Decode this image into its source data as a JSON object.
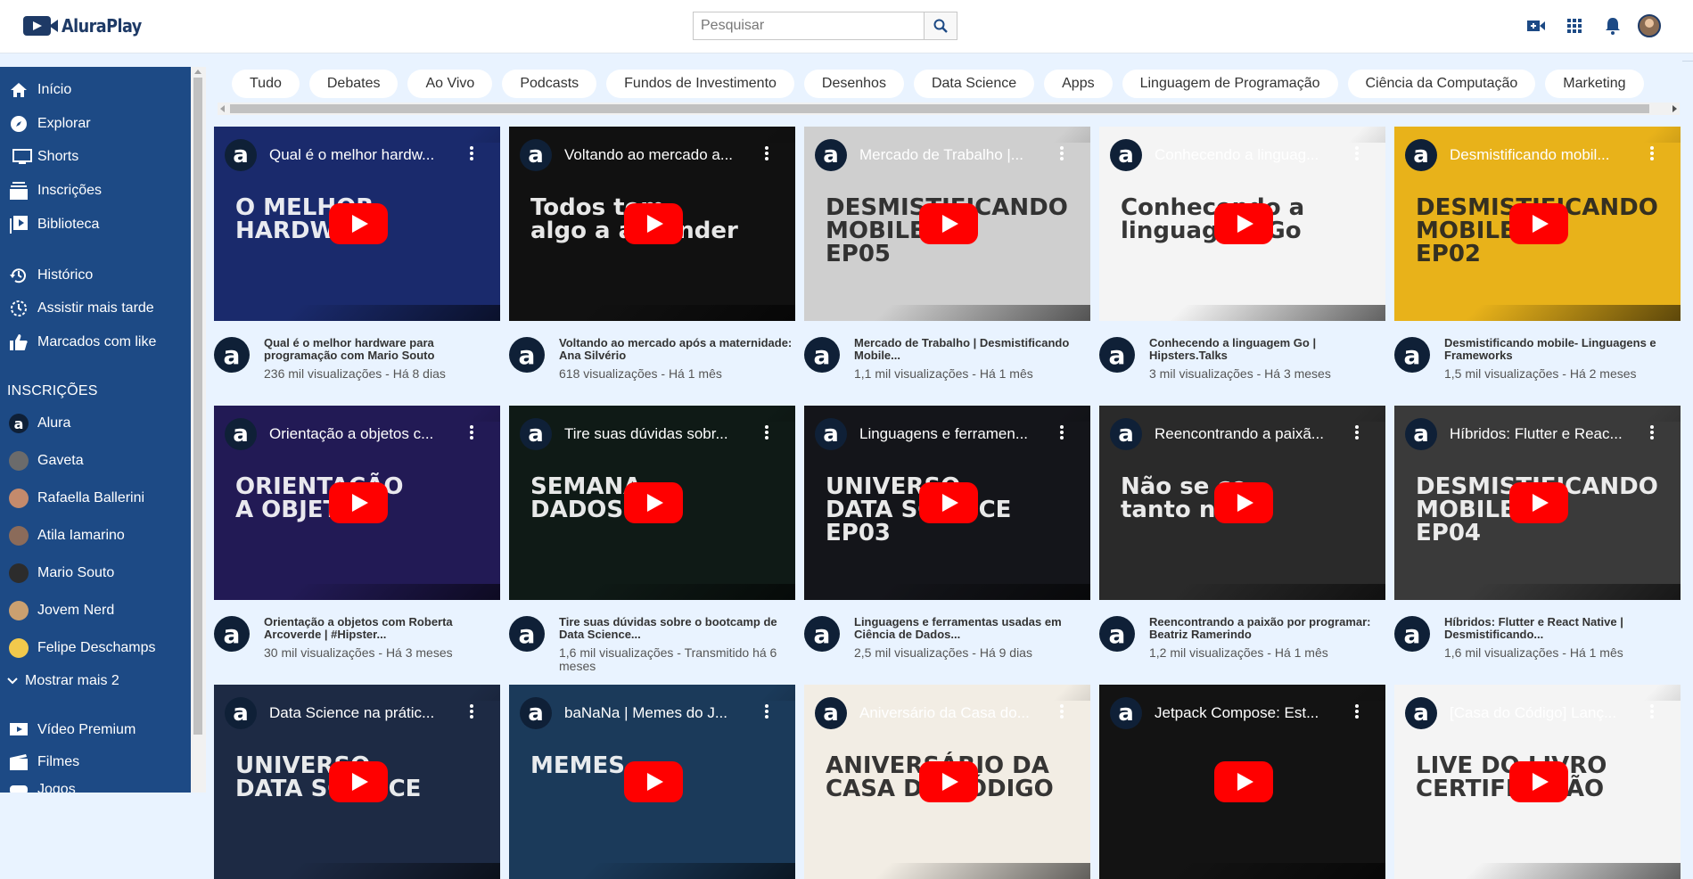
{
  "header": {
    "logo_text": "AluraPlay",
    "search_placeholder": "Pesquisar",
    "icons": [
      "search-icon",
      "video-camera-icon",
      "apps-grid-icon",
      "bell-icon",
      "avatar"
    ]
  },
  "sidebar": {
    "main": [
      {
        "label": "Início",
        "icon": "home-icon"
      },
      {
        "label": "Explorar",
        "icon": "compass-icon"
      },
      {
        "label": "Shorts",
        "icon": "monitor-icon"
      },
      {
        "label": "Inscrições",
        "icon": "subscriptions-icon"
      },
      {
        "label": "Biblioteca",
        "icon": "library-icon"
      }
    ],
    "secondary": [
      {
        "label": "Histórico",
        "icon": "history-icon"
      },
      {
        "label": "Assistir mais tarde",
        "icon": "clock-icon"
      },
      {
        "label": "Marcados com like",
        "icon": "thumbs-up-icon"
      }
    ],
    "subscriptions_header": "INSCRIÇÕES",
    "channels": [
      {
        "label": "Alura",
        "color": "#0f2037"
      },
      {
        "label": "Gaveta",
        "color": "#6b6b6b"
      },
      {
        "label": "Rafaella Ballerini",
        "color": "#c48a6c"
      },
      {
        "label": "Atila Iamarino",
        "color": "#8b6b5a"
      },
      {
        "label": "Mario Souto",
        "color": "#2c2c2c"
      },
      {
        "label": "Jovem Nerd",
        "color": "#caa070"
      },
      {
        "label": "Felipe Deschamps",
        "color": "#f2c94c"
      }
    ],
    "show_more": "Mostrar mais 2",
    "extra": [
      {
        "label": "Vídeo Premium",
        "icon": "premium-icon"
      },
      {
        "label": "Filmes",
        "icon": "film-icon"
      },
      {
        "label": "Jogos",
        "icon": "gamepad-icon"
      }
    ]
  },
  "chips": [
    "Tudo",
    "Debates",
    "Ao Vivo",
    "Podcasts",
    "Fundos de Investimento",
    "Desenhos",
    "Data Science",
    "Apps",
    "Linguagem de Programação",
    "Ciência da Computação",
    "Marketing"
  ],
  "videos": [
    {
      "thumb_title": "Qual é o melhor hardw...",
      "title": "Qual é o melhor hardware para programação com Mario Souto",
      "stats": "236 mil visualizações - Há 8 dias",
      "bg": "#1a2a6c",
      "overlay": "O MELHOR\nHARDWARE"
    },
    {
      "thumb_title": "Voltando ao mercado a...",
      "title": "Voltando ao mercado após a maternidade: Ana Silvério",
      "stats": "618 visualizações - Há 1 mês",
      "bg": "#111111",
      "overlay": "Todos tem\nalgo a aprender"
    },
    {
      "thumb_title": "Mercado de Trabalho |...",
      "title": "Mercado de Trabalho | Desmistificando Mobile...",
      "stats": "1,1 mil visualizações - Há 1 mês",
      "bg": "#cfcfcf",
      "overlay": "DESMISTIFICANDO\nMOBILE\nEP05"
    },
    {
      "thumb_title": "Conhecendo a linguag...",
      "title": "Conhecendo a linguagem Go | Hipsters.Talks",
      "stats": "3 mil visualizações - Há 3 meses",
      "bg": "#f4f4f4",
      "overlay": "Conhecendo a\nlinguagem Go"
    },
    {
      "thumb_title": "Desmistificando mobil...",
      "title": "Desmistificando mobile- Linguagens e Frameworks",
      "stats": "1,5 mil visualizações - Há 2 meses",
      "bg": "#e8b21a",
      "overlay": "DESMISTIFICANDO\nMOBILE\nEP02"
    },
    {
      "thumb_title": "Orientação a objetos c...",
      "title": "Orientação a objetos com Roberta Arcoverde | #Hipster...",
      "stats": "30 mil visualizações - Há 3 meses",
      "bg": "#221a55",
      "overlay": "ORIENTAÇÃO\nA OBJETOS"
    },
    {
      "thumb_title": "Tire suas dúvidas sobr...",
      "title": "Tire suas dúvidas sobre o bootcamp de Data Science...",
      "stats": "1,6 mil visualizações - Transmitido há 6 meses",
      "bg": "#0f1a16",
      "overlay": "SEMANA\nDADOS"
    },
    {
      "thumb_title": "Linguagens e ferramen...",
      "title": "Linguagens e ferramentas usadas em Ciência de Dados...",
      "stats": "2,5 mil visualizações - Há 9 dias",
      "bg": "#14151a",
      "overlay": "UNIVERSO\nDATA SCIENCE\nEP03"
    },
    {
      "thumb_title": "Reencontrando a paixã...",
      "title": "Reencontrando a paixão por programar: Beatriz Ramerindo",
      "stats": "1,2 mil visualizações - Há 1 mês",
      "bg": "#2a2a2a",
      "overlay": "Não se co\ntanto no i"
    },
    {
      "thumb_title": "Híbridos: Flutter e Reac...",
      "title": "Híbridos: Flutter e React Native | Desmistificando...",
      "stats": "1,6 mil visualizações - Há 1 mês",
      "bg": "#3a3a3a",
      "overlay": "DESMISTIFICANDO\nMOBILE\nEP04"
    },
    {
      "thumb_title": "Data Science na prátic...",
      "title": "",
      "stats": "",
      "bg": "#1d2a44",
      "overlay": "UNIVERSO\nDATA SCIENCE"
    },
    {
      "thumb_title": "baNaNa | Memes do J...",
      "title": "",
      "stats": "",
      "bg": "#1b3a5a",
      "overlay": "MEMES"
    },
    {
      "thumb_title": "Aniversário da Casa do...",
      "title": "",
      "stats": "",
      "bg": "#f2ede4",
      "overlay": "ANIVERSÁRIO DA\nCASA DO CÓDIGO"
    },
    {
      "thumb_title": "Jetpack Compose: Est...",
      "title": "",
      "stats": "",
      "bg": "#131313",
      "overlay": ""
    },
    {
      "thumb_title": "[Casa do Código] Lanç...",
      "title": "",
      "stats": "",
      "bg": "#f4f4f4",
      "overlay": "LIVE DO LIVRO\nCERTIFICAÇÃO"
    }
  ]
}
